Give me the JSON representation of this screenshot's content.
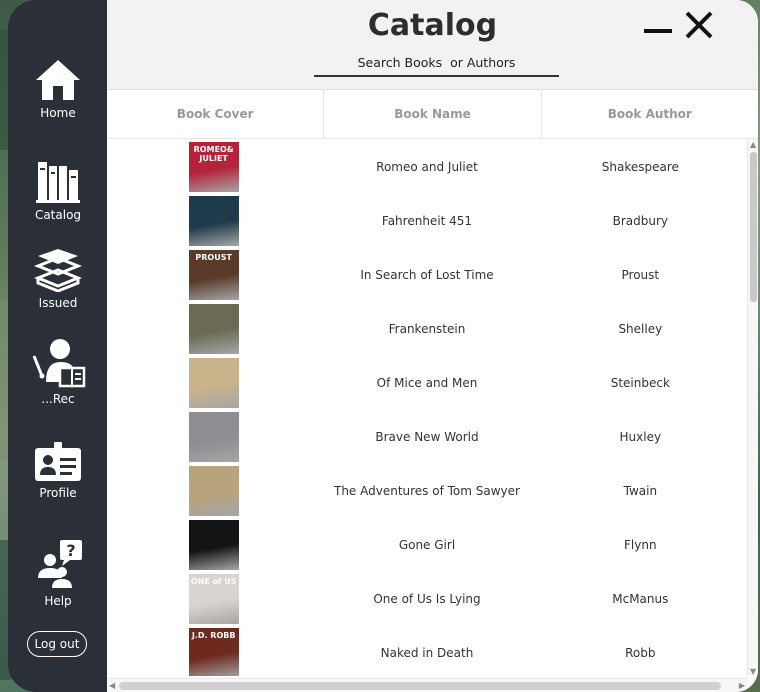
{
  "sidebar": {
    "items": [
      {
        "label": "Home",
        "icon": "home-icon"
      },
      {
        "label": "Catalog",
        "icon": "books-icon"
      },
      {
        "label": "Issued",
        "icon": "book-stack-icon"
      },
      {
        "label": "...Rec",
        "icon": "teacher-icon"
      },
      {
        "label": "Profile",
        "icon": "id-card-icon"
      },
      {
        "label": "Help",
        "icon": "help-icon"
      }
    ],
    "logout_label": "Log out"
  },
  "header": {
    "title": "Catalog",
    "search_placeholder": "Search Books  or Authors"
  },
  "table": {
    "columns": [
      "Book Cover",
      "Book Name",
      "Book Author"
    ],
    "rows": [
      {
        "name": "Romeo and Juliet",
        "author": "Shakespeare",
        "cover_text": "ROMEO& JULIET",
        "cover_color": "#b5233a"
      },
      {
        "name": "Fahrenheit 451",
        "author": "Bradbury",
        "cover_text": "",
        "cover_color": "#1f3a4a"
      },
      {
        "name": "In Search of Lost Time",
        "author": "Proust",
        "cover_text": "PROUST",
        "cover_color": "#5a3b2a"
      },
      {
        "name": "Frankenstein",
        "author": "Shelley",
        "cover_text": "",
        "cover_color": "#6b6b55"
      },
      {
        "name": "Of Mice and Men",
        "author": "Steinbeck",
        "cover_text": "",
        "cover_color": "#c9b38a"
      },
      {
        "name": "Brave New World",
        "author": "Huxley",
        "cover_text": "",
        "cover_color": "#8d8d92"
      },
      {
        "name": "The Adventures of Tom Sawyer",
        "author": "Twain",
        "cover_text": "",
        "cover_color": "#b8a37d"
      },
      {
        "name": "Gone Girl",
        "author": "Flynn",
        "cover_text": "",
        "cover_color": "#141414"
      },
      {
        "name": "One of Us Is Lying",
        "author": "McManus",
        "cover_text": "ONE of US",
        "cover_color": "#d9d4cf"
      },
      {
        "name": "Naked in Death",
        "author": "Robb",
        "cover_text": "J.D. ROBB",
        "cover_color": "#6e2a1f"
      }
    ]
  },
  "colors": {
    "sidebar": "#2b3038",
    "header": "#f2f2f2",
    "accent": "#2d2d2d"
  }
}
